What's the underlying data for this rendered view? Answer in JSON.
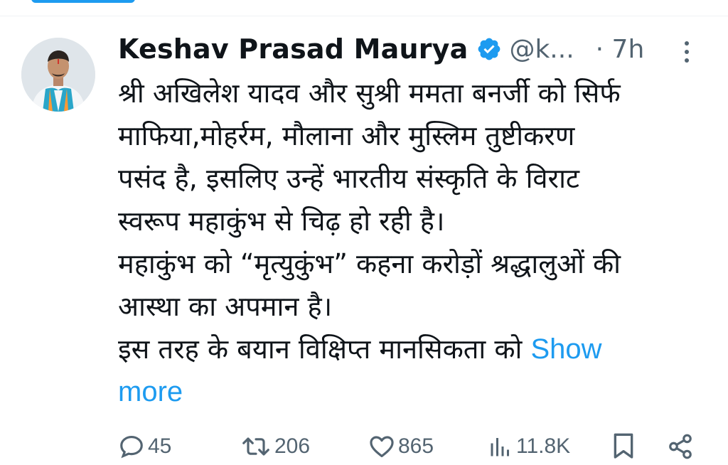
{
  "tweet": {
    "author": {
      "name": "Keshav Prasad Maurya",
      "handle": "@k...",
      "verified_icon": "verified-badge-icon"
    },
    "time_prefix": "·",
    "time": "7h",
    "body_lines": [
      "श्री अखिलेश यादव और सुश्री ममता बनर्जी को सिर्फ",
      "माफिया,मोहर्रम, मौलाना और मुस्लिम तुष्टीकरण",
      "पसंद है, इसलिए उन्हें भारतीय संस्कृति के विराट",
      "स्वरूप महाकुंभ से चिढ़ हो रही है।",
      "महाकुंभ को “मृत्युकुंभ” कहना करोड़ों श्रद्धालुओं की",
      "आस्था का अपमान है।",
      "इस तरह के बयान विक्षिप्त मानसिकता को"
    ],
    "show_more_word1": "Show",
    "show_more_word2": "more",
    "stats": {
      "replies": "45",
      "reposts": "206",
      "likes": "865",
      "views": "11.8K"
    }
  },
  "colors": {
    "accent": "#1d9bf0",
    "secondary_text": "#536471",
    "primary_text": "#0f1419"
  }
}
